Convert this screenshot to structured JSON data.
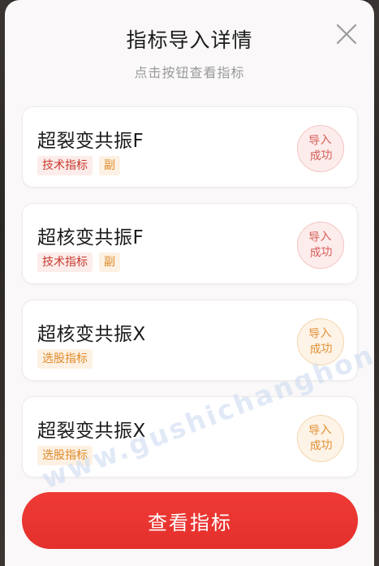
{
  "dialog": {
    "title": "指标导入详情",
    "subtitle": "点击按钮查看指标",
    "close_icon": "close-icon"
  },
  "items": [
    {
      "name": "超裂变共振F",
      "tags": [
        {
          "label": "技术指标",
          "color": "red"
        },
        {
          "label": "副",
          "color": "orange"
        }
      ],
      "status_line1": "导入",
      "status_line2": "成功",
      "status_color": "red"
    },
    {
      "name": "超核变共振F",
      "tags": [
        {
          "label": "技术指标",
          "color": "red"
        },
        {
          "label": "副",
          "color": "orange"
        }
      ],
      "status_line1": "导入",
      "status_line2": "成功",
      "status_color": "red"
    },
    {
      "name": "超核变共振X",
      "tags": [
        {
          "label": "选股指标",
          "color": "orange"
        }
      ],
      "status_line1": "导入",
      "status_line2": "成功",
      "status_color": "orange"
    },
    {
      "name": "超裂变共振X",
      "tags": [
        {
          "label": "选股指标",
          "color": "orange"
        }
      ],
      "status_line1": "导入",
      "status_line2": "成功",
      "status_color": "orange"
    }
  ],
  "primary_button": {
    "label": "查看指标"
  },
  "watermark": "www.gushichanghong.com",
  "colors": {
    "accent_red": "#e4302c",
    "tag_red": "#c83a30",
    "tag_orange": "#e08a2a"
  }
}
